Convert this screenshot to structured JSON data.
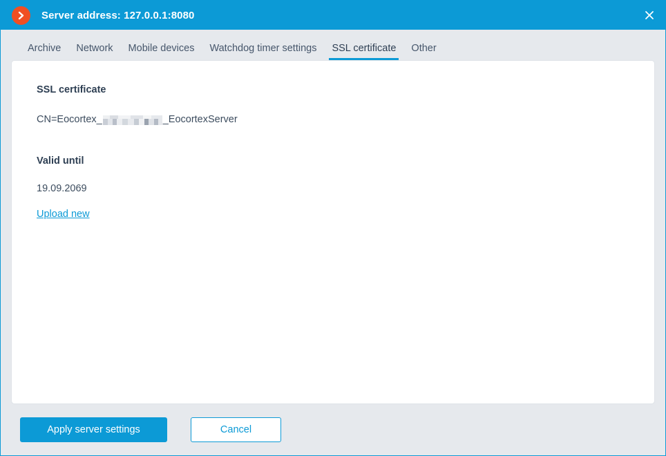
{
  "window": {
    "title": "Server address: 127.0.0.1:8080",
    "logo_icon": "chevron-right-circle-icon",
    "close_icon": "close-icon",
    "accent_color": "#0c9ad6",
    "logo_color": "#f04f23",
    "background_color": "#e6e9ed"
  },
  "tabs": [
    {
      "label": "Archive",
      "active": false
    },
    {
      "label": "Network",
      "active": false
    },
    {
      "label": "Mobile devices",
      "active": false
    },
    {
      "label": "Watchdog timer settings",
      "active": false
    },
    {
      "label": "SSL certificate",
      "active": true
    },
    {
      "label": "Other",
      "active": false
    }
  ],
  "main": {
    "ssl_heading": "SSL certificate",
    "cert_prefix": "CN=Eocortex_",
    "cert_redacted": "",
    "cert_suffix": "_EocortexServer",
    "valid_heading": "Valid until",
    "valid_date": "19.09.2069",
    "upload_link": "Upload new"
  },
  "footer": {
    "apply_label": "Apply server settings",
    "cancel_label": "Cancel"
  }
}
